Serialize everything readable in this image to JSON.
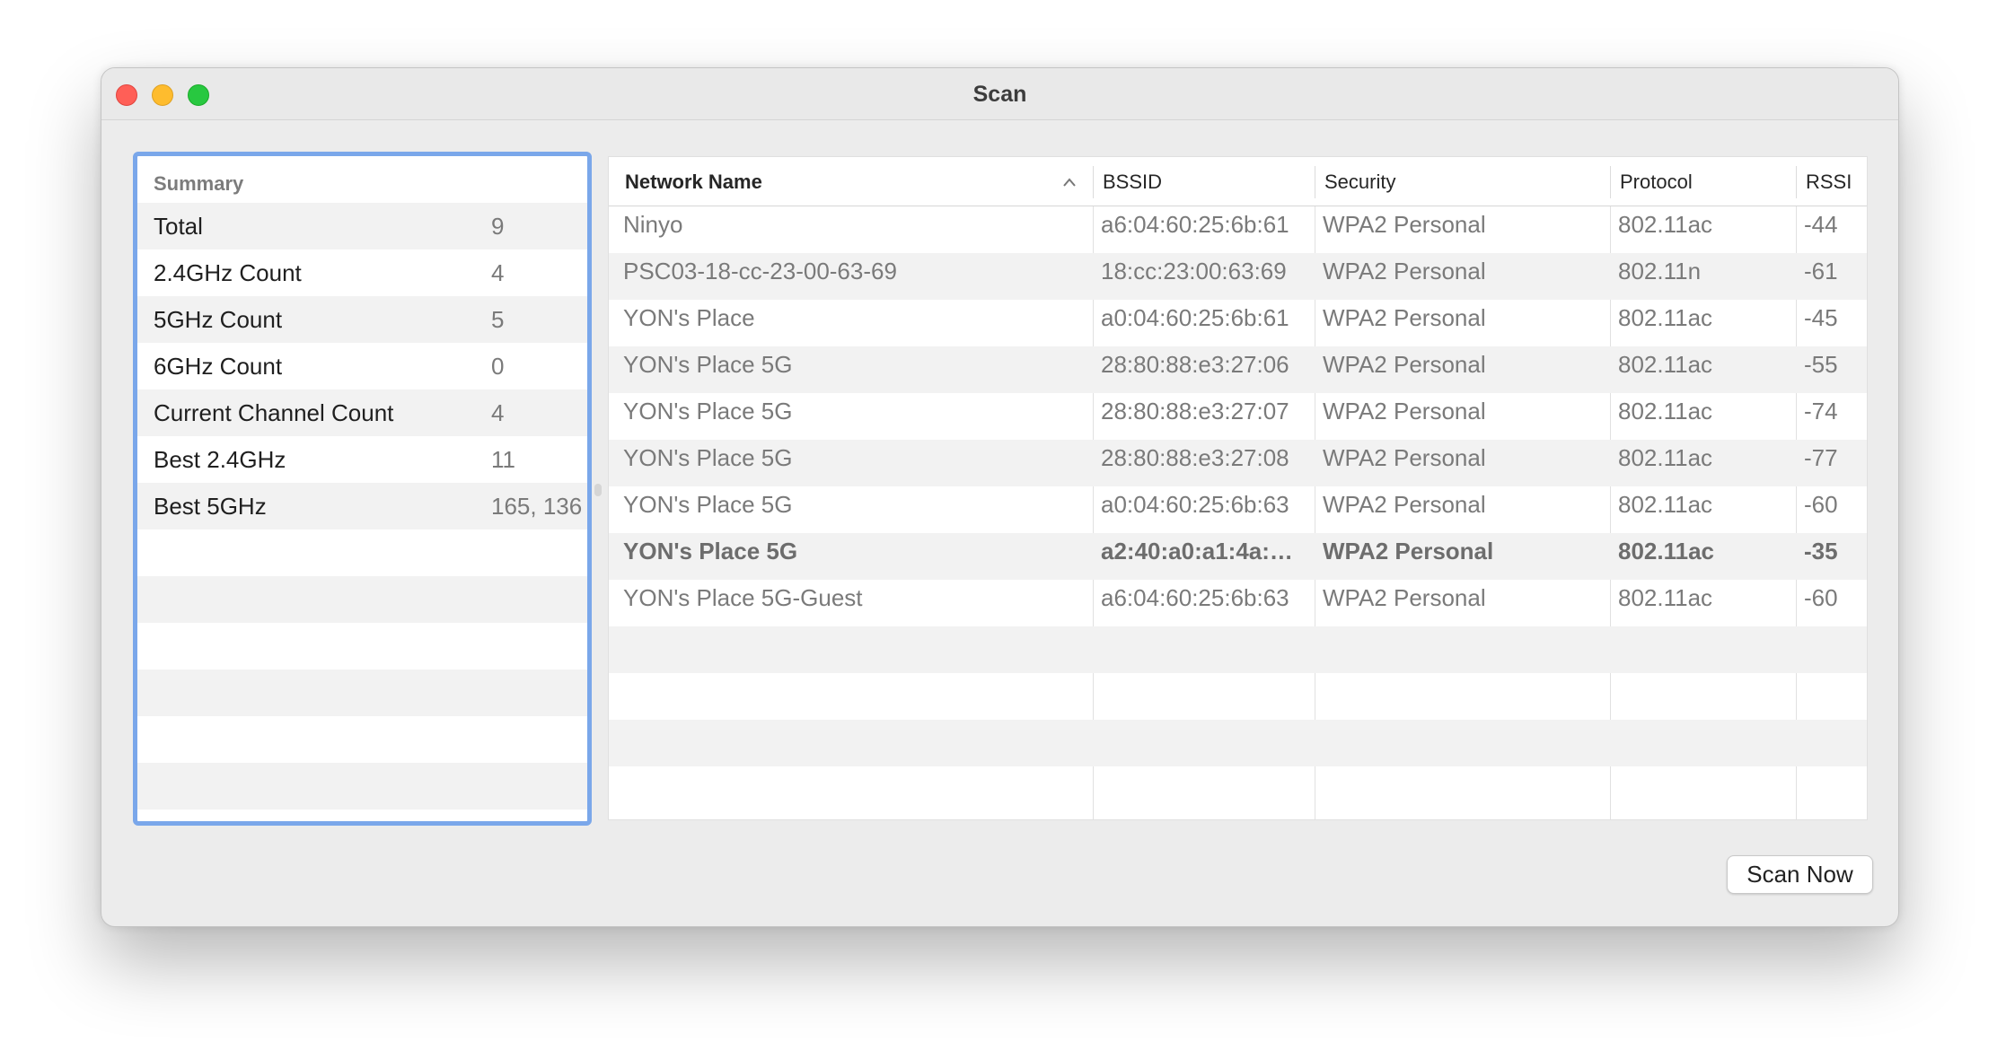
{
  "window": {
    "title": "Scan"
  },
  "summary": {
    "header": "Summary",
    "rows": [
      {
        "label": "Total",
        "value": "9"
      },
      {
        "label": "2.4GHz Count",
        "value": "4"
      },
      {
        "label": "5GHz Count",
        "value": "5"
      },
      {
        "label": "6GHz Count",
        "value": "0"
      },
      {
        "label": "Current Channel Count",
        "value": "4"
      },
      {
        "label": "Best 2.4GHz",
        "value": "11"
      },
      {
        "label": "Best 5GHz",
        "value": "165, 136"
      }
    ]
  },
  "networks": {
    "columns": [
      "Network Name",
      "BSSID",
      "Security",
      "Protocol",
      "RSSI"
    ],
    "sort_column": "Network Name",
    "sort_icon": "chevron-up-icon",
    "rows": [
      {
        "name": "Ninyo",
        "bssid": "a6:04:60:25:6b:61",
        "security": "WPA2 Personal",
        "protocol": "802.11ac",
        "rssi": "-44"
      },
      {
        "name": "PSC03-18-cc-23-00-63-69",
        "bssid": "18:cc:23:00:63:69",
        "security": "WPA2 Personal",
        "protocol": "802.11n",
        "rssi": "-61"
      },
      {
        "name": "YON's Place",
        "bssid": "a0:04:60:25:6b:61",
        "security": "WPA2 Personal",
        "protocol": "802.11ac",
        "rssi": "-45"
      },
      {
        "name": "YON's Place 5G",
        "bssid": "28:80:88:e3:27:06",
        "security": "WPA2 Personal",
        "protocol": "802.11ac",
        "rssi": "-55"
      },
      {
        "name": "YON's Place 5G",
        "bssid": "28:80:88:e3:27:07",
        "security": "WPA2 Personal",
        "protocol": "802.11ac",
        "rssi": "-74"
      },
      {
        "name": "YON's Place 5G",
        "bssid": "28:80:88:e3:27:08",
        "security": "WPA2 Personal",
        "protocol": "802.11ac",
        "rssi": "-77"
      },
      {
        "name": "YON's Place 5G",
        "bssid": "a0:04:60:25:6b:63",
        "security": "WPA2 Personal",
        "protocol": "802.11ac",
        "rssi": "-60"
      },
      {
        "name": "YON's Place 5G",
        "bssid": "a2:40:a0:a1:4a:…",
        "security": "WPA2 Personal",
        "protocol": "802.11ac",
        "rssi": "-35",
        "current": true
      },
      {
        "name": "YON's Place 5G-Guest",
        "bssid": "a6:04:60:25:6b:63",
        "security": "WPA2 Personal",
        "protocol": "802.11ac",
        "rssi": "-60"
      }
    ]
  },
  "footer": {
    "scan_button": "Scan Now"
  },
  "colors": {
    "focus_ring": "#7aa7ea",
    "close": "#ff5f57",
    "minimize": "#febc2e",
    "zoom": "#28c840"
  }
}
